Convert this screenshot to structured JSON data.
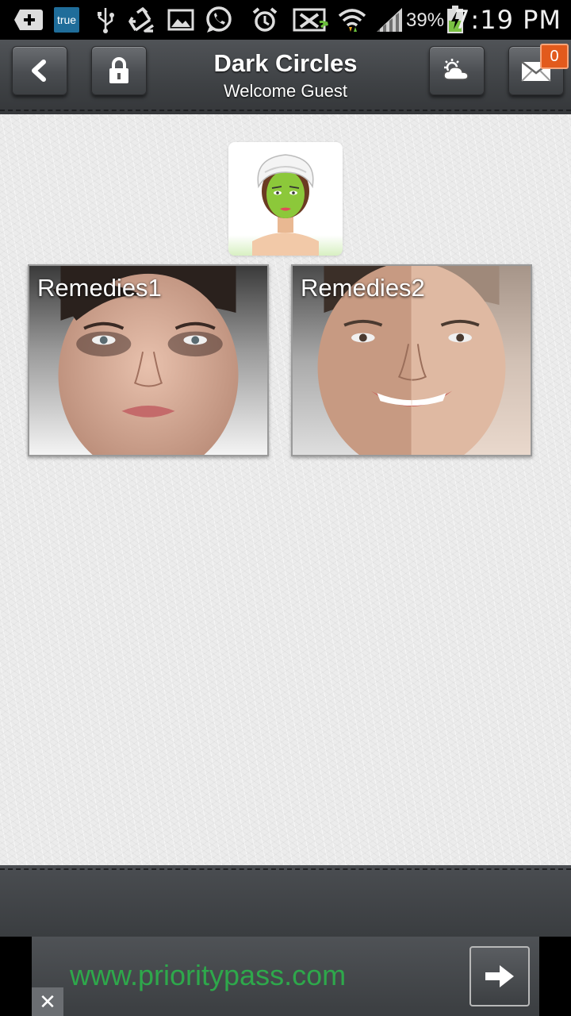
{
  "status_bar": {
    "carrier_badge": "true",
    "battery_percent": "39%",
    "time": "7:19 PM",
    "icons": [
      "add-icon",
      "usb-icon",
      "recycle-icon",
      "gallery-icon",
      "whatsapp-icon",
      "alarm-icon",
      "no-signal-icon",
      "wifi-icon",
      "signal-icon",
      "battery-icon"
    ]
  },
  "header": {
    "title": "Dark Circles",
    "subtitle": "Welcome Guest",
    "notification_count": "0",
    "buttons": [
      "back-icon",
      "lock-icon",
      "weather-icon",
      "mail-icon"
    ]
  },
  "content": {
    "tiles": [
      {
        "label": "Remedies1"
      },
      {
        "label": "Remedies2"
      }
    ]
  },
  "ad": {
    "url": "www.prioritypass.com",
    "close_label": "✕"
  },
  "colors": {
    "header_bg": "#3e4144",
    "badge_bg": "#e25a1c",
    "ad_text": "#2ea84b",
    "content_bg": "#ececec"
  }
}
